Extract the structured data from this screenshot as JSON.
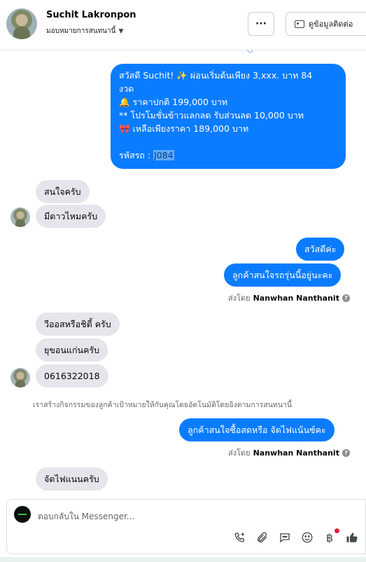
{
  "header": {
    "contact_name": "Suchit Lakronpon",
    "assignment_label": "มอบหมายการสนทนานี้",
    "more_label": "···",
    "contact_info_label": "ดูข้อมูลติดต่อ"
  },
  "messages": {
    "promo": {
      "line1": "สวัสดี Suchit! ✨  ผ่อนเริ่มต้นเพียง 3,xxx. บาท 84",
      "line2": "งวด",
      "line3": "🔔 ราคาปกติ 199,000 บาท",
      "line4": "** โปรโมชั่นข้าวแลกลด รับส่วนลด 10,000 บาท",
      "line5": "🎀  เหลือเพียงราคา 189,000 บาท",
      "code_label": " รหัสรถ : ",
      "code_value": "J084"
    },
    "in1": "สนใจครับ",
    "in2": "มีดาวไหมครับ",
    "out1": "สวัสดีค่ะ",
    "out2": "ลูกค้าสนใจรถรุ่นนี้อยู่นะคะ",
    "sent_by_prefix": "ส่งโดย",
    "sent_by_name": "Nanwhan Nanthanit",
    "in3": "วีออสหรือชิตี้ ครับ",
    "in4": "ยุขอนแก่นครับ",
    "in5": "0616322018",
    "system_note": "เราสร้างกิจกรรมของลูกค้าเป้าหมายให้กับคุณโดยอัตโนมัติโดยอิงตามการสนทนานี้",
    "out3": "ลูกค้าสนใจซื้อสดหรือ จัดไฟแน้นซ์คะ",
    "in6": "จัดไฟแนนครับ"
  },
  "composer": {
    "placeholder": "ตอบกลับใน Messenger..."
  },
  "icons": [
    "call-add-icon",
    "attachment-icon",
    "saved-reply-icon",
    "emoji-icon",
    "baht-payment-icon",
    "like-icon"
  ],
  "colors": {
    "outgoing_bubble": "#0a7cff",
    "incoming_bubble": "#e4e6eb",
    "notify_dot": "#e41e3f"
  }
}
